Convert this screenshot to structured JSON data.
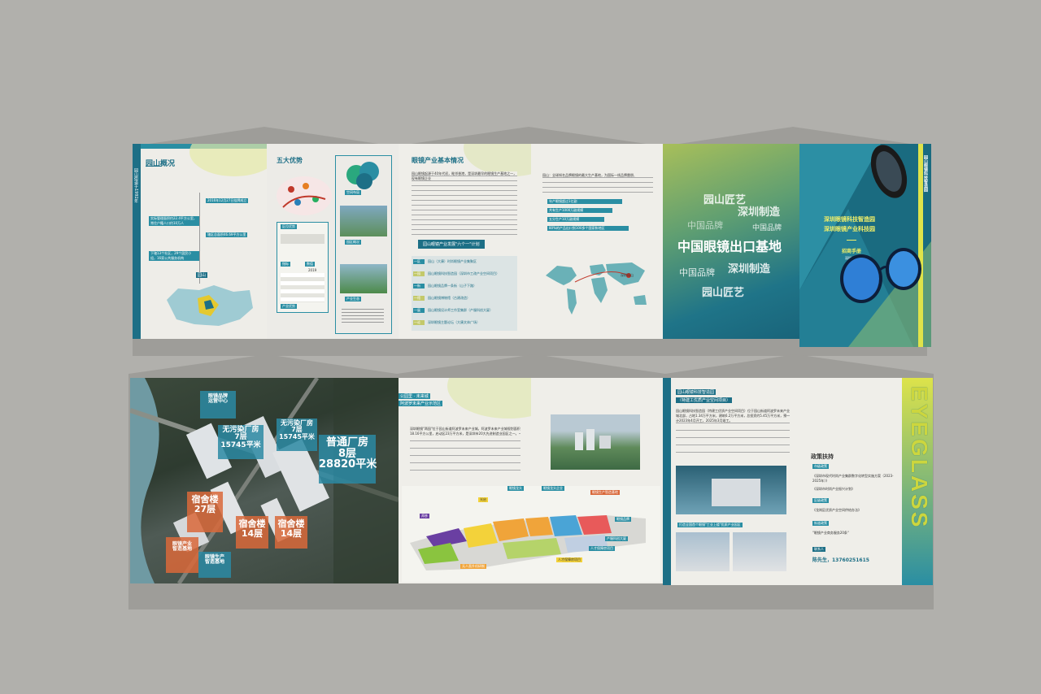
{
  "top": {
    "p1_title": "园山概况",
    "p1_side": "园山街道于1992年",
    "p1_tags": [
      "2016年12月27日挂牌成立",
      "实际管理面积约22.4平方公里，常住户籍人口约10万人",
      "辖区总面积46.69平方公里",
      "下辖13个社区，29个居民小组，16家公共服务机构"
    ],
    "p1_map_label": "园山",
    "p2_title": "五大优势",
    "p2_box_heads": [
      "区位优势",
      "产业优势"
    ],
    "p2_table_head": [
      "指标",
      "数值"
    ],
    "p2_table_first": "2019",
    "p2_sub": [
      "空间布局",
      "园区概况",
      "产业生态"
    ],
    "p3_title": "眼镜产业基本情况",
    "p3_para": "园山眼镜起源于40年代初，毗邻香港，是深圳最早的眼镜生产基地之一，现有眼镜企业",
    "p3_plan_title": "园山眼镜产业发展\"六个一\"计划",
    "p3_plan": [
      {
        "n": "一区",
        "t": "园山（大康）时尚眼镜产业集聚区"
      },
      {
        "n": "一园",
        "t": "园山眼镜科技智造园（深圳市工改产业空间项目）"
      },
      {
        "n": "一街",
        "t": "园山眼镜品牌一条街（山子下路）"
      },
      {
        "n": "一馆",
        "t": "园山眼镜博物馆（古建改造）"
      },
      {
        "n": "一展",
        "t": "园山眼镜设计师工作室集群（产服科创大厦）"
      },
      {
        "n": "一论",
        "t": "深圳眼镜主题论坛（大康文体广场）"
      }
    ],
    "p4_intro": "园山：全球知名品牌眼镜的最大生产基地，为国际一线品牌雷朋、",
    "p4_bars": [
      "年产眼镜超过1亿副",
      "共有生产1000万副规模",
      "五分生产10万副规模",
      "80%的产品出口到100多个国家和地区"
    ],
    "p4_map_label": "深圳园山",
    "p5_words": [
      "园山匠艺",
      "深圳制造",
      "中国品牌",
      "中国眼镜出口基地",
      "中国品牌",
      "深圳制造",
      "园山匠艺",
      "中国品牌"
    ],
    "p6_title1": "深圳眼镜科技智造园",
    "p6_title2": "深圳眼镜产业科技园",
    "p6_sub": "招商手册",
    "p6_loc": "深圳·园山",
    "p6_side": "园山眼镜科技智造园"
  },
  "bottom": {
    "aerial_labels": [
      {
        "t": "眼镜品牌\n运营中心",
        "c": "#2b8aa3"
      },
      {
        "t": "无污染厂房\n7层\n15745平米",
        "c": "#2b8aa3"
      },
      {
        "t": "无污染厂房\n7层\n15745平米",
        "c": "#2b8aa3"
      },
      {
        "t": "普通厂房\n8层\n28820平米",
        "c": "#2b8aa3"
      },
      {
        "t": "宿舍楼\n27层",
        "c": "#d9683a"
      },
      {
        "t": "宿舍楼\n14层",
        "c": "#d9683a"
      },
      {
        "t": "宿舍楼\n14层",
        "c": "#d9683a"
      },
      {
        "t": "眼镜产业\n智造基地",
        "c": "#d9683a"
      },
      {
        "t": "眼镜生产\n智造基地",
        "c": "#2b8aa3"
      }
    ],
    "p2_tag1": "公园里 · 未来城",
    "p2_tag2": "阿波罗未来产业示范区",
    "p2_para": "深圳眼镜\"两园\"位于园山街道阿波罗未来产业城。阿波罗未来产业城规划面积18.16平方公里，启动区23万平方米，是深圳市20大先进制造业园区之一。",
    "map_tags": [
      "眼镜龙头",
      "眼镜龙头企业",
      "眼镜生产智造基地",
      "邦彦",
      "光启",
      "眼镜品牌",
      "产服科创大厦",
      "人才保障房项目",
      "无人直升机研制",
      "人才保障房项目"
    ],
    "p4_title1": "园山眼镜科技智造园",
    "p4_title2": "（特建工优质产业空间项目）",
    "p4_para": "园山眼镜科技智造园（特建工优质产业空间项目）位于园山街道阿波罗未来产业城北部，占地1.34万平方米，建筑6.2万平方米，总投资约5.45万平方米，预计2023年4月开工，2025年3月竣工。",
    "p4_photo_caption": "打造全国首个眼镜\"工业上楼\"优质产业园区",
    "p5_title": "政策扶持",
    "p5_secs": [
      "市级政策",
      "区级政策",
      "街道政策"
    ],
    "p5_items": [
      "《深圳市现代时尚产业集群数字化转型实施方案（2023-2025年）》",
      "《深圳市时尚产业振兴计划》",
      "《龙岗区优质产业空间供给办法》",
      "\"眼镜产业商务服务20条\""
    ],
    "p5_contact_label": "联系人",
    "p5_contact": "陈先生，13760251615",
    "side_word": "EYEGLASS"
  }
}
